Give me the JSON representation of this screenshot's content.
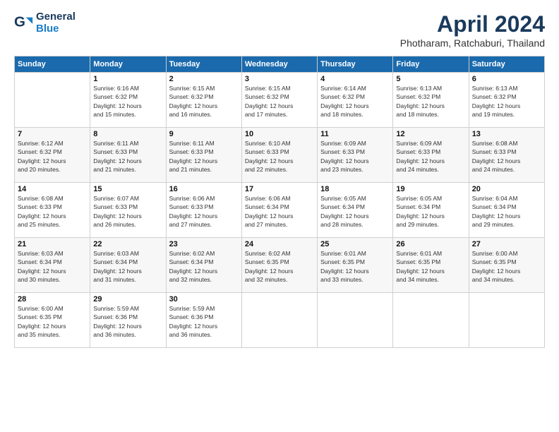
{
  "header": {
    "logo_line1": "General",
    "logo_line2": "Blue",
    "month": "April 2024",
    "location": "Photharam, Ratchaburi, Thailand"
  },
  "days_of_week": [
    "Sunday",
    "Monday",
    "Tuesday",
    "Wednesday",
    "Thursday",
    "Friday",
    "Saturday"
  ],
  "weeks": [
    [
      {
        "num": "",
        "info": ""
      },
      {
        "num": "1",
        "info": "Sunrise: 6:16 AM\nSunset: 6:32 PM\nDaylight: 12 hours\nand 15 minutes."
      },
      {
        "num": "2",
        "info": "Sunrise: 6:15 AM\nSunset: 6:32 PM\nDaylight: 12 hours\nand 16 minutes."
      },
      {
        "num": "3",
        "info": "Sunrise: 6:15 AM\nSunset: 6:32 PM\nDaylight: 12 hours\nand 17 minutes."
      },
      {
        "num": "4",
        "info": "Sunrise: 6:14 AM\nSunset: 6:32 PM\nDaylight: 12 hours\nand 18 minutes."
      },
      {
        "num": "5",
        "info": "Sunrise: 6:13 AM\nSunset: 6:32 PM\nDaylight: 12 hours\nand 18 minutes."
      },
      {
        "num": "6",
        "info": "Sunrise: 6:13 AM\nSunset: 6:32 PM\nDaylight: 12 hours\nand 19 minutes."
      }
    ],
    [
      {
        "num": "7",
        "info": "Sunrise: 6:12 AM\nSunset: 6:32 PM\nDaylight: 12 hours\nand 20 minutes."
      },
      {
        "num": "8",
        "info": "Sunrise: 6:11 AM\nSunset: 6:33 PM\nDaylight: 12 hours\nand 21 minutes."
      },
      {
        "num": "9",
        "info": "Sunrise: 6:11 AM\nSunset: 6:33 PM\nDaylight: 12 hours\nand 21 minutes."
      },
      {
        "num": "10",
        "info": "Sunrise: 6:10 AM\nSunset: 6:33 PM\nDaylight: 12 hours\nand 22 minutes."
      },
      {
        "num": "11",
        "info": "Sunrise: 6:09 AM\nSunset: 6:33 PM\nDaylight: 12 hours\nand 23 minutes."
      },
      {
        "num": "12",
        "info": "Sunrise: 6:09 AM\nSunset: 6:33 PM\nDaylight: 12 hours\nand 24 minutes."
      },
      {
        "num": "13",
        "info": "Sunrise: 6:08 AM\nSunset: 6:33 PM\nDaylight: 12 hours\nand 24 minutes."
      }
    ],
    [
      {
        "num": "14",
        "info": "Sunrise: 6:08 AM\nSunset: 6:33 PM\nDaylight: 12 hours\nand 25 minutes."
      },
      {
        "num": "15",
        "info": "Sunrise: 6:07 AM\nSunset: 6:33 PM\nDaylight: 12 hours\nand 26 minutes."
      },
      {
        "num": "16",
        "info": "Sunrise: 6:06 AM\nSunset: 6:33 PM\nDaylight: 12 hours\nand 27 minutes."
      },
      {
        "num": "17",
        "info": "Sunrise: 6:06 AM\nSunset: 6:34 PM\nDaylight: 12 hours\nand 27 minutes."
      },
      {
        "num": "18",
        "info": "Sunrise: 6:05 AM\nSunset: 6:34 PM\nDaylight: 12 hours\nand 28 minutes."
      },
      {
        "num": "19",
        "info": "Sunrise: 6:05 AM\nSunset: 6:34 PM\nDaylight: 12 hours\nand 29 minutes."
      },
      {
        "num": "20",
        "info": "Sunrise: 6:04 AM\nSunset: 6:34 PM\nDaylight: 12 hours\nand 29 minutes."
      }
    ],
    [
      {
        "num": "21",
        "info": "Sunrise: 6:03 AM\nSunset: 6:34 PM\nDaylight: 12 hours\nand 30 minutes."
      },
      {
        "num": "22",
        "info": "Sunrise: 6:03 AM\nSunset: 6:34 PM\nDaylight: 12 hours\nand 31 minutes."
      },
      {
        "num": "23",
        "info": "Sunrise: 6:02 AM\nSunset: 6:34 PM\nDaylight: 12 hours\nand 32 minutes."
      },
      {
        "num": "24",
        "info": "Sunrise: 6:02 AM\nSunset: 6:35 PM\nDaylight: 12 hours\nand 32 minutes."
      },
      {
        "num": "25",
        "info": "Sunrise: 6:01 AM\nSunset: 6:35 PM\nDaylight: 12 hours\nand 33 minutes."
      },
      {
        "num": "26",
        "info": "Sunrise: 6:01 AM\nSunset: 6:35 PM\nDaylight: 12 hours\nand 34 minutes."
      },
      {
        "num": "27",
        "info": "Sunrise: 6:00 AM\nSunset: 6:35 PM\nDaylight: 12 hours\nand 34 minutes."
      }
    ],
    [
      {
        "num": "28",
        "info": "Sunrise: 6:00 AM\nSunset: 6:35 PM\nDaylight: 12 hours\nand 35 minutes."
      },
      {
        "num": "29",
        "info": "Sunrise: 5:59 AM\nSunset: 6:36 PM\nDaylight: 12 hours\nand 36 minutes."
      },
      {
        "num": "30",
        "info": "Sunrise: 5:59 AM\nSunset: 6:36 PM\nDaylight: 12 hours\nand 36 minutes."
      },
      {
        "num": "",
        "info": ""
      },
      {
        "num": "",
        "info": ""
      },
      {
        "num": "",
        "info": ""
      },
      {
        "num": "",
        "info": ""
      }
    ]
  ]
}
